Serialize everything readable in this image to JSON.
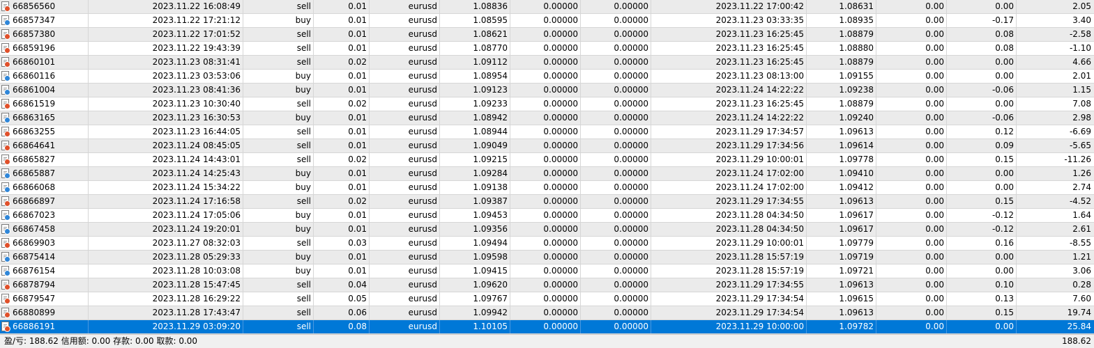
{
  "colors": {
    "selected_row": "#0078d7",
    "alt_row": "#ebebeb",
    "sell_marker": "#e0502a",
    "buy_marker": "#2f86d8"
  },
  "trades": [
    {
      "ticket": "66856560",
      "open_time": "2023.11.22 16:08:49",
      "type": "sell",
      "volume": "0.01",
      "symbol": "eurusd",
      "open_price": "1.08836",
      "sl": "0.00000",
      "tp": "0.00000",
      "close_time": "2023.11.22 17:00:42",
      "close_price": "1.08631",
      "commission": "0.00",
      "swap": "0.00",
      "profit": "2.05"
    },
    {
      "ticket": "66857347",
      "open_time": "2023.11.22 17:21:12",
      "type": "buy",
      "volume": "0.01",
      "symbol": "eurusd",
      "open_price": "1.08595",
      "sl": "0.00000",
      "tp": "0.00000",
      "close_time": "2023.11.23 03:33:35",
      "close_price": "1.08935",
      "commission": "0.00",
      "swap": "-0.17",
      "profit": "3.40"
    },
    {
      "ticket": "66857380",
      "open_time": "2023.11.22 17:01:52",
      "type": "sell",
      "volume": "0.01",
      "symbol": "eurusd",
      "open_price": "1.08621",
      "sl": "0.00000",
      "tp": "0.00000",
      "close_time": "2023.11.23 16:25:45",
      "close_price": "1.08879",
      "commission": "0.00",
      "swap": "0.08",
      "profit": "-2.58"
    },
    {
      "ticket": "66859196",
      "open_time": "2023.11.22 19:43:39",
      "type": "sell",
      "volume": "0.01",
      "symbol": "eurusd",
      "open_price": "1.08770",
      "sl": "0.00000",
      "tp": "0.00000",
      "close_time": "2023.11.23 16:25:45",
      "close_price": "1.08880",
      "commission": "0.00",
      "swap": "0.08",
      "profit": "-1.10"
    },
    {
      "ticket": "66860101",
      "open_time": "2023.11.23 08:31:41",
      "type": "sell",
      "volume": "0.02",
      "symbol": "eurusd",
      "open_price": "1.09112",
      "sl": "0.00000",
      "tp": "0.00000",
      "close_time": "2023.11.23 16:25:45",
      "close_price": "1.08879",
      "commission": "0.00",
      "swap": "0.00",
      "profit": "4.66"
    },
    {
      "ticket": "66860116",
      "open_time": "2023.11.23 03:53:06",
      "type": "buy",
      "volume": "0.01",
      "symbol": "eurusd",
      "open_price": "1.08954",
      "sl": "0.00000",
      "tp": "0.00000",
      "close_time": "2023.11.23 08:13:00",
      "close_price": "1.09155",
      "commission": "0.00",
      "swap": "0.00",
      "profit": "2.01"
    },
    {
      "ticket": "66861004",
      "open_time": "2023.11.23 08:41:36",
      "type": "buy",
      "volume": "0.01",
      "symbol": "eurusd",
      "open_price": "1.09123",
      "sl": "0.00000",
      "tp": "0.00000",
      "close_time": "2023.11.24 14:22:22",
      "close_price": "1.09238",
      "commission": "0.00",
      "swap": "-0.06",
      "profit": "1.15"
    },
    {
      "ticket": "66861519",
      "open_time": "2023.11.23 10:30:40",
      "type": "sell",
      "volume": "0.02",
      "symbol": "eurusd",
      "open_price": "1.09233",
      "sl": "0.00000",
      "tp": "0.00000",
      "close_time": "2023.11.23 16:25:45",
      "close_price": "1.08879",
      "commission": "0.00",
      "swap": "0.00",
      "profit": "7.08"
    },
    {
      "ticket": "66863165",
      "open_time": "2023.11.23 16:30:53",
      "type": "buy",
      "volume": "0.01",
      "symbol": "eurusd",
      "open_price": "1.08942",
      "sl": "0.00000",
      "tp": "0.00000",
      "close_time": "2023.11.24 14:22:22",
      "close_price": "1.09240",
      "commission": "0.00",
      "swap": "-0.06",
      "profit": "2.98"
    },
    {
      "ticket": "66863255",
      "open_time": "2023.11.23 16:44:05",
      "type": "sell",
      "volume": "0.01",
      "symbol": "eurusd",
      "open_price": "1.08944",
      "sl": "0.00000",
      "tp": "0.00000",
      "close_time": "2023.11.29 17:34:57",
      "close_price": "1.09613",
      "commission": "0.00",
      "swap": "0.12",
      "profit": "-6.69"
    },
    {
      "ticket": "66864641",
      "open_time": "2023.11.24 08:45:05",
      "type": "sell",
      "volume": "0.01",
      "symbol": "eurusd",
      "open_price": "1.09049",
      "sl": "0.00000",
      "tp": "0.00000",
      "close_time": "2023.11.29 17:34:56",
      "close_price": "1.09614",
      "commission": "0.00",
      "swap": "0.09",
      "profit": "-5.65"
    },
    {
      "ticket": "66865827",
      "open_time": "2023.11.24 14:43:01",
      "type": "sell",
      "volume": "0.02",
      "symbol": "eurusd",
      "open_price": "1.09215",
      "sl": "0.00000",
      "tp": "0.00000",
      "close_time": "2023.11.29 10:00:01",
      "close_price": "1.09778",
      "commission": "0.00",
      "swap": "0.15",
      "profit": "-11.26"
    },
    {
      "ticket": "66865887",
      "open_time": "2023.11.24 14:25:43",
      "type": "buy",
      "volume": "0.01",
      "symbol": "eurusd",
      "open_price": "1.09284",
      "sl": "0.00000",
      "tp": "0.00000",
      "close_time": "2023.11.24 17:02:00",
      "close_price": "1.09410",
      "commission": "0.00",
      "swap": "0.00",
      "profit": "1.26"
    },
    {
      "ticket": "66866068",
      "open_time": "2023.11.24 15:34:22",
      "type": "buy",
      "volume": "0.01",
      "symbol": "eurusd",
      "open_price": "1.09138",
      "sl": "0.00000",
      "tp": "0.00000",
      "close_time": "2023.11.24 17:02:00",
      "close_price": "1.09412",
      "commission": "0.00",
      "swap": "0.00",
      "profit": "2.74"
    },
    {
      "ticket": "66866897",
      "open_time": "2023.11.24 17:16:58",
      "type": "sell",
      "volume": "0.02",
      "symbol": "eurusd",
      "open_price": "1.09387",
      "sl": "0.00000",
      "tp": "0.00000",
      "close_time": "2023.11.29 17:34:55",
      "close_price": "1.09613",
      "commission": "0.00",
      "swap": "0.15",
      "profit": "-4.52"
    },
    {
      "ticket": "66867023",
      "open_time": "2023.11.24 17:05:06",
      "type": "buy",
      "volume": "0.01",
      "symbol": "eurusd",
      "open_price": "1.09453",
      "sl": "0.00000",
      "tp": "0.00000",
      "close_time": "2023.11.28 04:34:50",
      "close_price": "1.09617",
      "commission": "0.00",
      "swap": "-0.12",
      "profit": "1.64"
    },
    {
      "ticket": "66867458",
      "open_time": "2023.11.24 19:20:01",
      "type": "buy",
      "volume": "0.01",
      "symbol": "eurusd",
      "open_price": "1.09356",
      "sl": "0.00000",
      "tp": "0.00000",
      "close_time": "2023.11.28 04:34:50",
      "close_price": "1.09617",
      "commission": "0.00",
      "swap": "-0.12",
      "profit": "2.61"
    },
    {
      "ticket": "66869903",
      "open_time": "2023.11.27 08:32:03",
      "type": "sell",
      "volume": "0.03",
      "symbol": "eurusd",
      "open_price": "1.09494",
      "sl": "0.00000",
      "tp": "0.00000",
      "close_time": "2023.11.29 10:00:01",
      "close_price": "1.09779",
      "commission": "0.00",
      "swap": "0.16",
      "profit": "-8.55"
    },
    {
      "ticket": "66875414",
      "open_time": "2023.11.28 05:29:33",
      "type": "buy",
      "volume": "0.01",
      "symbol": "eurusd",
      "open_price": "1.09598",
      "sl": "0.00000",
      "tp": "0.00000",
      "close_time": "2023.11.28 15:57:19",
      "close_price": "1.09719",
      "commission": "0.00",
      "swap": "0.00",
      "profit": "1.21"
    },
    {
      "ticket": "66876154",
      "open_time": "2023.11.28 10:03:08",
      "type": "buy",
      "volume": "0.01",
      "symbol": "eurusd",
      "open_price": "1.09415",
      "sl": "0.00000",
      "tp": "0.00000",
      "close_time": "2023.11.28 15:57:19",
      "close_price": "1.09721",
      "commission": "0.00",
      "swap": "0.00",
      "profit": "3.06"
    },
    {
      "ticket": "66878794",
      "open_time": "2023.11.28 15:47:45",
      "type": "sell",
      "volume": "0.04",
      "symbol": "eurusd",
      "open_price": "1.09620",
      "sl": "0.00000",
      "tp": "0.00000",
      "close_time": "2023.11.29 17:34:55",
      "close_price": "1.09613",
      "commission": "0.00",
      "swap": "0.10",
      "profit": "0.28"
    },
    {
      "ticket": "66879547",
      "open_time": "2023.11.28 16:29:22",
      "type": "sell",
      "volume": "0.05",
      "symbol": "eurusd",
      "open_price": "1.09767",
      "sl": "0.00000",
      "tp": "0.00000",
      "close_time": "2023.11.29 17:34:54",
      "close_price": "1.09615",
      "commission": "0.00",
      "swap": "0.13",
      "profit": "7.60"
    },
    {
      "ticket": "66880899",
      "open_time": "2023.11.28 17:43:47",
      "type": "sell",
      "volume": "0.06",
      "symbol": "eurusd",
      "open_price": "1.09942",
      "sl": "0.00000",
      "tp": "0.00000",
      "close_time": "2023.11.29 17:34:54",
      "close_price": "1.09613",
      "commission": "0.00",
      "swap": "0.15",
      "profit": "19.74"
    },
    {
      "ticket": "66886191",
      "open_time": "2023.11.29 03:09:20",
      "type": "sell",
      "volume": "0.08",
      "symbol": "eurusd",
      "open_price": "1.10105",
      "sl": "0.00000",
      "tp": "0.00000",
      "close_time": "2023.11.29 10:00:00",
      "close_price": "1.09782",
      "commission": "0.00",
      "swap": "0.00",
      "profit": "25.84",
      "selected": true
    }
  ],
  "status": {
    "summary": "盈/亏: 188.62  信用额: 0.00  存款: 0.00  取款: 0.00",
    "total": "188.62"
  }
}
